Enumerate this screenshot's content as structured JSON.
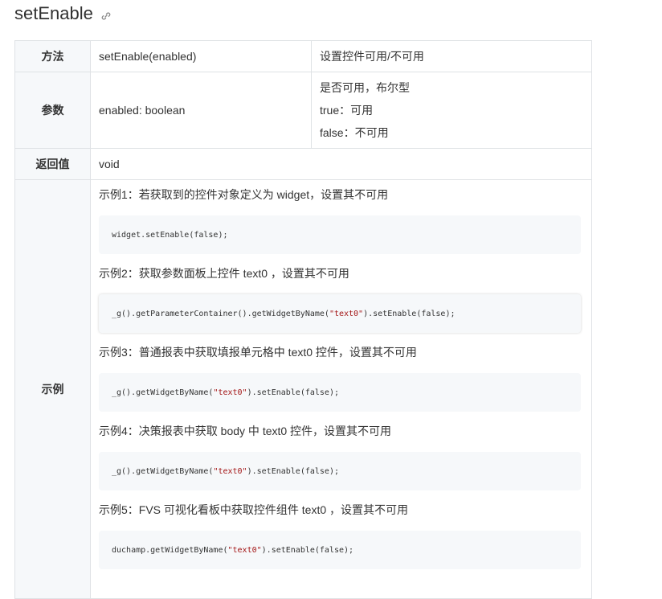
{
  "title": "setEnable",
  "rows": {
    "method": {
      "label": "方法",
      "signature": "setEnable(enabled)",
      "desc": "设置控件可用/不可用"
    },
    "params": {
      "label": "参数",
      "name": "enabled: boolean",
      "lines": [
        "是否可用，布尔型",
        "true：可用",
        "false：不可用"
      ]
    },
    "returns": {
      "label": "返回值",
      "value": "void"
    },
    "example": {
      "label": "示例"
    }
  },
  "examples": [
    {
      "desc": "示例1：若获取到的控件对象定义为 widget，设置其不可用",
      "code_pre": "widget.setEnable(false);",
      "code_str": "",
      "code_post": ""
    },
    {
      "desc": "示例2：获取参数面板上控件 text0 ，设置其不可用",
      "code_pre": "_g().getParameterContainer().getWidgetByName(",
      "code_str": "\"text0\"",
      "code_post": ").setEnable(false);"
    },
    {
      "desc": "示例3：普通报表中获取填报单元格中 text0 控件，设置其不可用",
      "code_pre": "_g().getWidgetByName(",
      "code_str": "\"text0\"",
      "code_post": ").setEnable(false);"
    },
    {
      "desc": "示例4：决策报表中获取 body 中 text0 控件，设置其不可用",
      "code_pre": "_g().getWidgetByName(",
      "code_str": "\"text0\"",
      "code_post": ").setEnable(false);"
    },
    {
      "desc": "示例5：FVS 可视化看板中获取控件组件 text0 ，设置其不可用",
      "code_pre": "duchamp.getWidgetByName(",
      "code_str": "\"text0\"",
      "code_post": ").setEnable(false);"
    }
  ],
  "colors": {
    "border": "#dfe2e5",
    "header_bg": "#f6f8fa",
    "code_bg": "#f6f8fa",
    "string": "#a31515"
  }
}
